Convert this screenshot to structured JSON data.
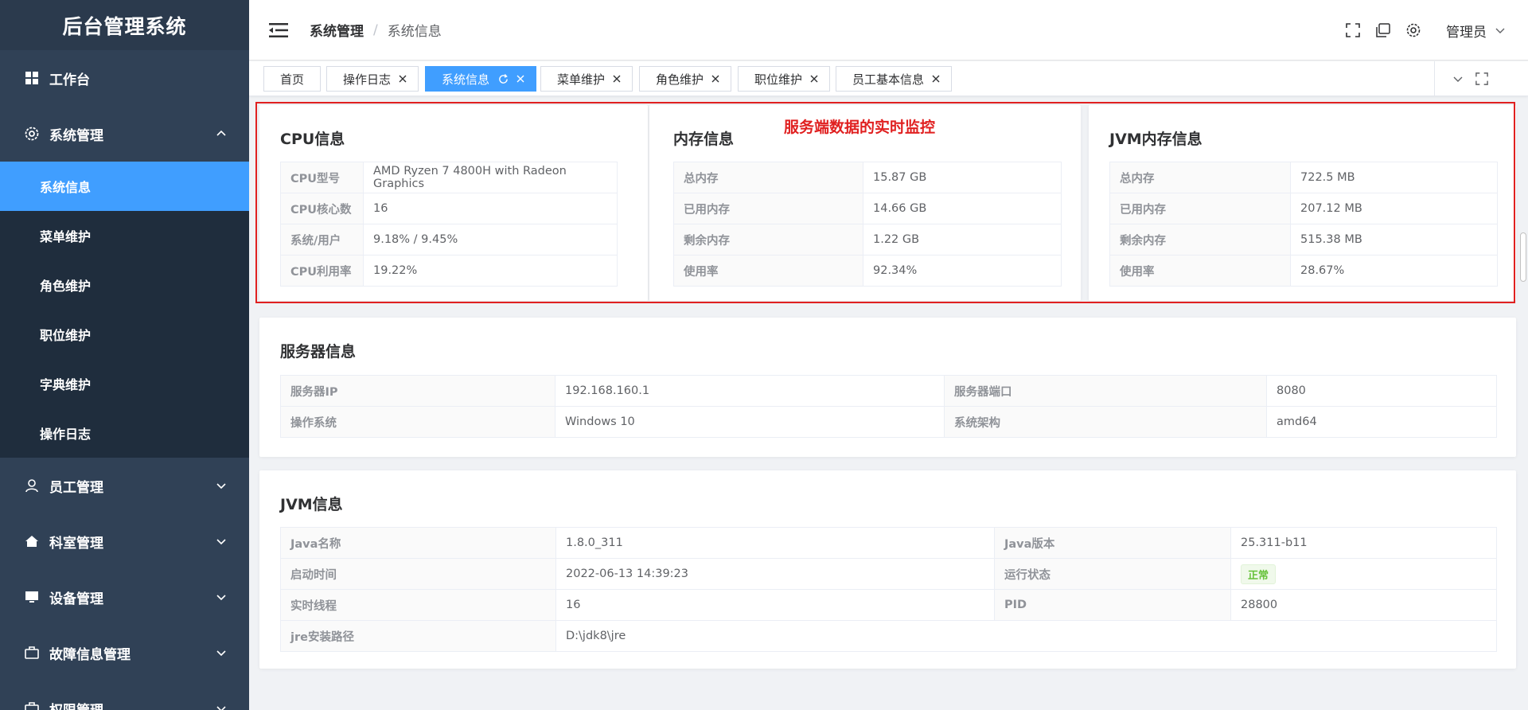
{
  "app": {
    "title": "后台管理系统"
  },
  "sidebar": {
    "items": [
      {
        "label": "工作台",
        "icon": "grid-icon"
      },
      {
        "label": "系统管理",
        "icon": "gear-icon",
        "expanded": true,
        "children": [
          "系统信息",
          "菜单维护",
          "角色维护",
          "职位维护",
          "字典维护",
          "操作日志"
        ],
        "active_child": "系统信息"
      },
      {
        "label": "员工管理",
        "icon": "user-icon"
      },
      {
        "label": "科室管理",
        "icon": "home-icon"
      },
      {
        "label": "设备管理",
        "icon": "monitor-icon"
      },
      {
        "label": "故障信息管理",
        "icon": "briefcase-icon"
      },
      {
        "label": "权限管理",
        "icon": "briefcase-icon"
      }
    ]
  },
  "header": {
    "breadcrumb": [
      "系统管理",
      "系统信息"
    ],
    "user": "管理员"
  },
  "tags": [
    {
      "label": "首页",
      "closable": false,
      "active": false
    },
    {
      "label": "操作日志",
      "closable": true,
      "active": false
    },
    {
      "label": "系统信息",
      "closable": true,
      "active": true
    },
    {
      "label": "菜单维护",
      "closable": true,
      "active": false
    },
    {
      "label": "角色维护",
      "closable": true,
      "active": false
    },
    {
      "label": "职位维护",
      "closable": true,
      "active": false
    },
    {
      "label": "员工基本信息",
      "closable": true,
      "active": false
    }
  ],
  "annotation": "服务端数据的实时监控",
  "cpu": {
    "title": "CPU信息",
    "rows": [
      {
        "label": "CPU型号",
        "value": "AMD Ryzen 7 4800H with Radeon Graphics"
      },
      {
        "label": "CPU核心数",
        "value": "16"
      },
      {
        "label": "系统/用户",
        "value": "9.18% / 9.45%"
      },
      {
        "label": "CPU利用率",
        "value": "19.22%"
      }
    ]
  },
  "memory": {
    "title": "内存信息",
    "rows": [
      {
        "label": "总内存",
        "value": "15.87 GB"
      },
      {
        "label": "已用内存",
        "value": "14.66 GB"
      },
      {
        "label": "剩余内存",
        "value": "1.22 GB"
      },
      {
        "label": "使用率",
        "value": "92.34%"
      }
    ]
  },
  "jvm_memory": {
    "title": "JVM内存信息",
    "rows": [
      {
        "label": "总内存",
        "value": "722.5 MB"
      },
      {
        "label": "已用内存",
        "value": "207.12 MB"
      },
      {
        "label": "剩余内存",
        "value": "515.38 MB"
      },
      {
        "label": "使用率",
        "value": "28.67%"
      }
    ]
  },
  "server": {
    "title": "服务器信息",
    "rows": [
      {
        "l1": "服务器IP",
        "v1": "192.168.160.1",
        "l2": "服务器端口",
        "v2": "8080"
      },
      {
        "l1": "操作系统",
        "v1": "Windows 10",
        "l2": "系统架构",
        "v2": "amd64"
      }
    ]
  },
  "jvm": {
    "title": "JVM信息",
    "rows": [
      {
        "l1": "Java名称",
        "v1": "1.8.0_311",
        "l2": "Java版本",
        "v2": "25.311-b11"
      },
      {
        "l1": "启动时间",
        "v1": "2022-06-13 14:39:23",
        "l2": "运行状态",
        "v2": "正常"
      },
      {
        "l1": "实时线程",
        "v1": "16",
        "l2": "PID",
        "v2": "28800"
      }
    ],
    "path_label": "jre安装路径",
    "path_value": "D:\\jdk8\\jre"
  },
  "colors": {
    "sidebar": "#304156",
    "submenu": "#1f2d3d",
    "accent": "#409eff",
    "annotation": "#e02020",
    "success": "#67c23a"
  }
}
